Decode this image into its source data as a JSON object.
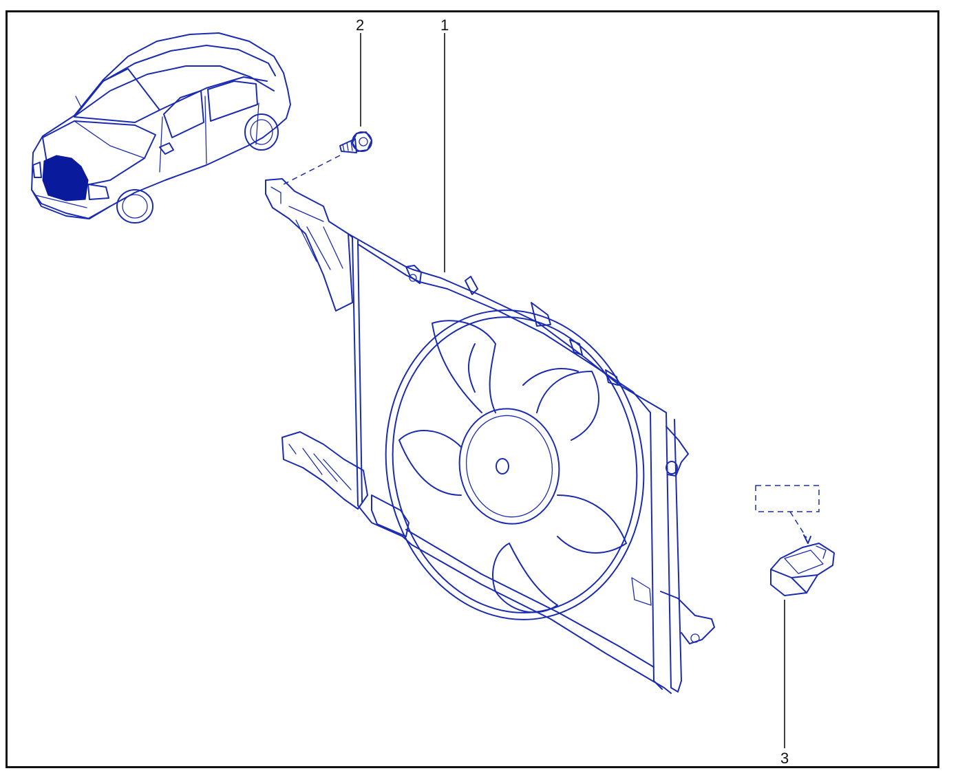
{
  "callouts": [
    {
      "id": "1",
      "label": "1"
    },
    {
      "id": "2",
      "label": "2"
    },
    {
      "id": "3",
      "label": "3"
    }
  ],
  "colors": {
    "ink": "#1a2bb0",
    "highlight": "#0a1a9c",
    "frame": "#111111",
    "background": "#ffffff"
  },
  "parts": [
    {
      "callout": "1",
      "icon": "cooling-fan-assembly-icon"
    },
    {
      "callout": "2",
      "icon": "bolt-icon"
    },
    {
      "callout": "3",
      "icon": "resistor-connector-icon"
    }
  ],
  "locator_icon": "car-front-highlight-icon"
}
